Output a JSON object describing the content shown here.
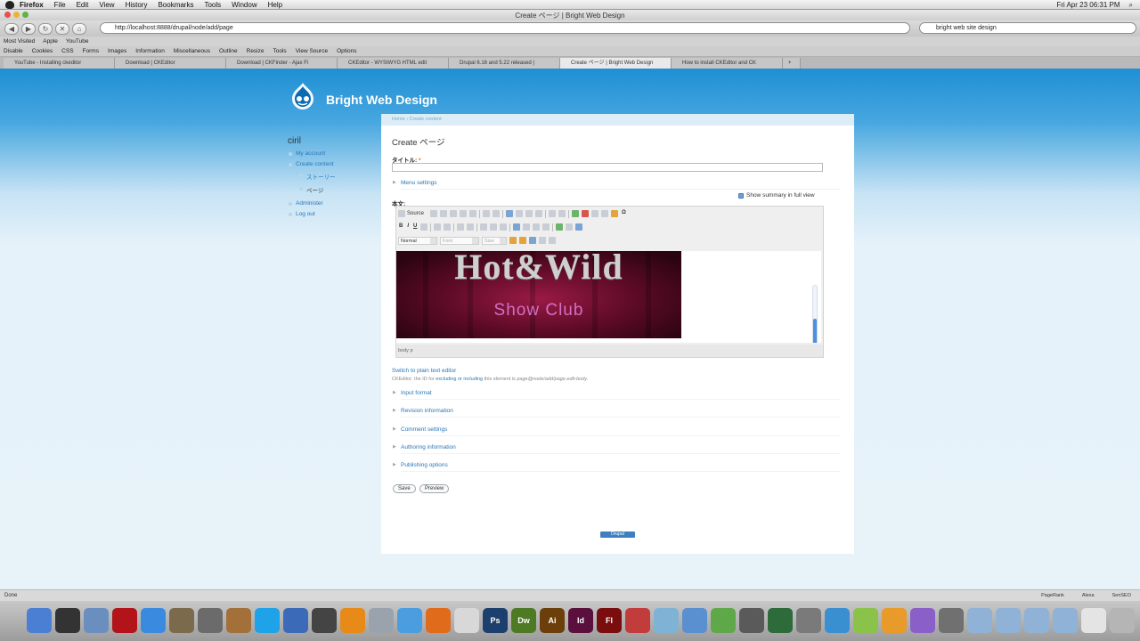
{
  "menubar": {
    "app": "Firefox",
    "items": [
      "File",
      "Edit",
      "View",
      "History",
      "Bookmarks",
      "Tools",
      "Window",
      "Help"
    ],
    "clock": "Fri Apr 23  06:31 PM"
  },
  "window": {
    "title": "Create ページ | Bright Web Design"
  },
  "nav": {
    "url": "http://localhost:8888/drupal/node/add/page",
    "search": "bright web site design"
  },
  "bookmarks": [
    "Most Visited",
    "Apple",
    "YouTube"
  ],
  "devbar": [
    "Disable",
    "Cookies",
    "CSS",
    "Forms",
    "Images",
    "Information",
    "Miscellaneous",
    "Outline",
    "Resize",
    "Tools",
    "View Source",
    "Options"
  ],
  "tabs": [
    "YouTube - Installing ckeditor",
    "Download | CKEditor",
    "Download | CKFinder - Ajax Fi",
    "CKEditor - WYSIWYG HTML edit",
    "Drupal 6.16 and 5.22 released |",
    "Create ページ | Bright Web Design",
    "How to install CKEditor and CK"
  ],
  "site": {
    "name": "Bright Web Design"
  },
  "sidebar": {
    "user": "ciril",
    "links": [
      {
        "label": "My account",
        "style": "top"
      },
      {
        "label": "Create content",
        "style": "top"
      },
      {
        "label": "ストーリー",
        "style": "sub"
      },
      {
        "label": "ページ",
        "style": "sub-plain"
      },
      {
        "label": "Administer",
        "style": "top"
      },
      {
        "label": "Log out",
        "style": "top"
      }
    ]
  },
  "content": {
    "breadcrumb": "Home › Create content",
    "page_title": "Create ページ",
    "title_label": "タイトル:",
    "required_mark": "*",
    "menu_settings": "Menu settings",
    "show_summary": "Show summary in full view",
    "body_label": "本文:",
    "switch_plain": "Switch to plain text editor",
    "id_note_prefix": "CKEditor: the ID for",
    "id_note_link1": "excluding or including",
    "id_note_middle": "this element is",
    "id_note_id": "page@node/add/page.edit-body.",
    "fieldsets": [
      "Input format",
      "Revision information",
      "Comment settings",
      "Authoring information",
      "Publishing options"
    ],
    "save": "Save",
    "preview": "Preview",
    "powered": "Drupal"
  },
  "editor": {
    "source_label": "Source",
    "format": "Normal",
    "font": "Font",
    "size": "Size",
    "status_path": "body  p",
    "bold": "B",
    "italic": "I",
    "underline": "U",
    "image_title": "Hot&Wild",
    "image_subtitle": "Show Club"
  },
  "statusbar": {
    "text": "Done",
    "right": [
      "PageRank",
      "Alexa",
      "SenSEO"
    ]
  },
  "dock": [
    {
      "name": "finder",
      "color": "#4a7fd4",
      "label": ""
    },
    {
      "name": "dashboard",
      "color": "#333333",
      "label": ""
    },
    {
      "name": "preview",
      "color": "#6a8fbf",
      "label": ""
    },
    {
      "name": "app-red",
      "color": "#b2141a",
      "label": ""
    },
    {
      "name": "itunes",
      "color": "#3a8be0",
      "label": ""
    },
    {
      "name": "iphoto",
      "color": "#7c6a4c",
      "label": ""
    },
    {
      "name": "app-star",
      "color": "#6b6b6b",
      "label": ""
    },
    {
      "name": "guitar",
      "color": "#a3703a",
      "label": ""
    },
    {
      "name": "skype",
      "color": "#1fa3e8",
      "label": ""
    },
    {
      "name": "xcode",
      "color": "#3b6bb8",
      "label": ""
    },
    {
      "name": "filmmaker",
      "color": "#444444",
      "label": ""
    },
    {
      "name": "vlc",
      "color": "#e88a18",
      "label": ""
    },
    {
      "name": "trash-util",
      "color": "#9aa3ad",
      "label": ""
    },
    {
      "name": "safari",
      "color": "#4a9ee0",
      "label": ""
    },
    {
      "name": "firefox",
      "color": "#e06b1a",
      "label": ""
    },
    {
      "name": "pages",
      "color": "#d8d8d8",
      "label": ""
    },
    {
      "name": "photoshop",
      "color": "#1c3f6e",
      "label": "Ps"
    },
    {
      "name": "dreamweaver",
      "color": "#4e7a23",
      "label": "Dw"
    },
    {
      "name": "illustrator",
      "color": "#6b3e0a",
      "label": "Ai"
    },
    {
      "name": "indesign",
      "color": "#5a0f3c",
      "label": "Id"
    },
    {
      "name": "flash",
      "color": "#7a0e0e",
      "label": "Fl"
    },
    {
      "name": "app-bag",
      "color": "#c33c3c",
      "label": ""
    },
    {
      "name": "app-jar",
      "color": "#7fb3d6",
      "label": ""
    },
    {
      "name": "app-store",
      "color": "#5a8fd0",
      "label": ""
    },
    {
      "name": "app-leaf",
      "color": "#5fa84a",
      "label": ""
    },
    {
      "name": "app-clock",
      "color": "#5a5a5a",
      "label": ""
    },
    {
      "name": "time-machine",
      "color": "#2d6b3a",
      "label": ""
    },
    {
      "name": "system-prefs",
      "color": "#7a7a7a",
      "label": ""
    },
    {
      "name": "app-w",
      "color": "#3a8fd0",
      "label": ""
    },
    {
      "name": "app-leaf2",
      "color": "#8bc34a",
      "label": ""
    },
    {
      "name": "app-p",
      "color": "#e89a2a",
      "label": ""
    },
    {
      "name": "app-e",
      "color": "#8a5fc8",
      "label": ""
    },
    {
      "name": "app-tools",
      "color": "#707070",
      "label": ""
    },
    {
      "name": "folder-1",
      "color": "#8fb2d6",
      "label": ""
    },
    {
      "name": "folder-2",
      "color": "#8fb2d6",
      "label": ""
    },
    {
      "name": "folder-3",
      "color": "#8fb2d6",
      "label": ""
    },
    {
      "name": "folder-4",
      "color": "#8fb2d6",
      "label": ""
    },
    {
      "name": "documents",
      "color": "#e4e4e4",
      "label": ""
    },
    {
      "name": "trash",
      "color": "#b5b5b5",
      "label": ""
    }
  ]
}
